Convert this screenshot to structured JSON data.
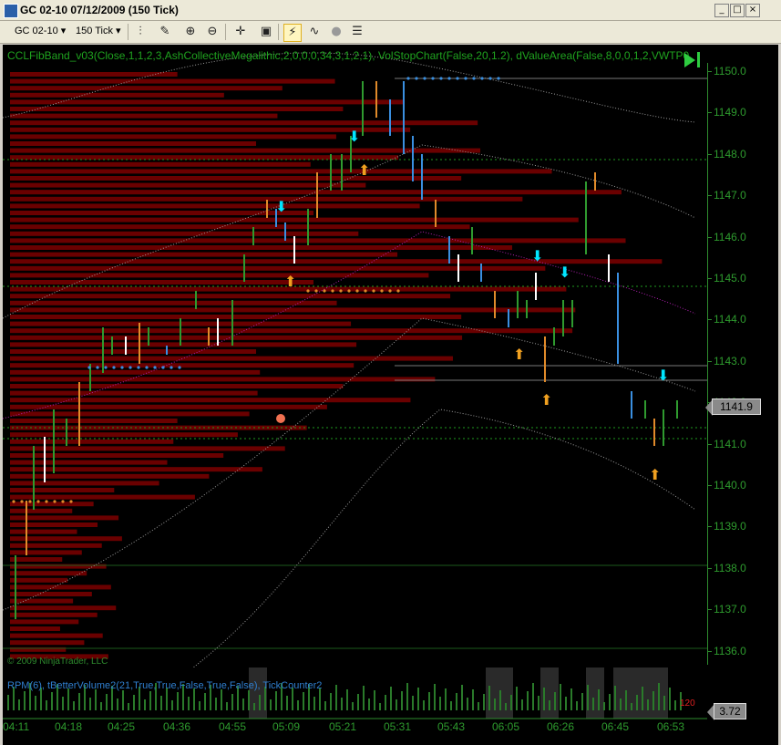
{
  "window": {
    "title": "GC 02-10  07/12/2009 (150 Tick)",
    "min_glyph": "_",
    "max_glyph": "□",
    "close_glyph": "×"
  },
  "toolbar": {
    "instrument": "GC 02-10",
    "interval": "150 Tick",
    "dropdown_glyph": "▾"
  },
  "chart": {
    "indicator_label": "CCLFibBand_v03(Close,1,1,2,3,AshCollectiveMegalithic,2,0,0,0,34,3,1,2,1),  VolStopChart(False,20,1.2),  dValueArea(False,8,0,0,1,2,VWTP0",
    "sub_indicator_label": "RPM(6),  tBetterVolume2(21,True,True,False,True,False),  TickCounter2",
    "copyright": "© 2009 NinjaTrader, LLC",
    "price_labels": [
      "1150.0",
      "1149.0",
      "1148.0",
      "1147.0",
      "1146.0",
      "1145.0",
      "1144.0",
      "1143.0",
      "1142.0",
      "1141.0",
      "1140.0",
      "1139.0",
      "1138.0",
      "1137.0",
      "1136.0"
    ],
    "current_price": "1141.9",
    "sub_value": "3.72",
    "sub_left": "120",
    "time_labels": [
      "04:11",
      "04:18",
      "04:25",
      "04:36",
      "04:55",
      "05:09",
      "05:21",
      "05:31",
      "05:43",
      "06:05",
      "06:26",
      "06:45",
      "06:53"
    ],
    "colors": {
      "background": "#000000",
      "grid_green": "#1f9a1f",
      "volume_profile": "#6a0000",
      "bar_up": "#2f9a2f",
      "bar_down": "#3a8fe0",
      "bar_orange": "#e08a2a",
      "bar_white": "#ffffff",
      "arrow_cyan": "#00e5ff",
      "arrow_orange": "#f0a020"
    }
  }
}
